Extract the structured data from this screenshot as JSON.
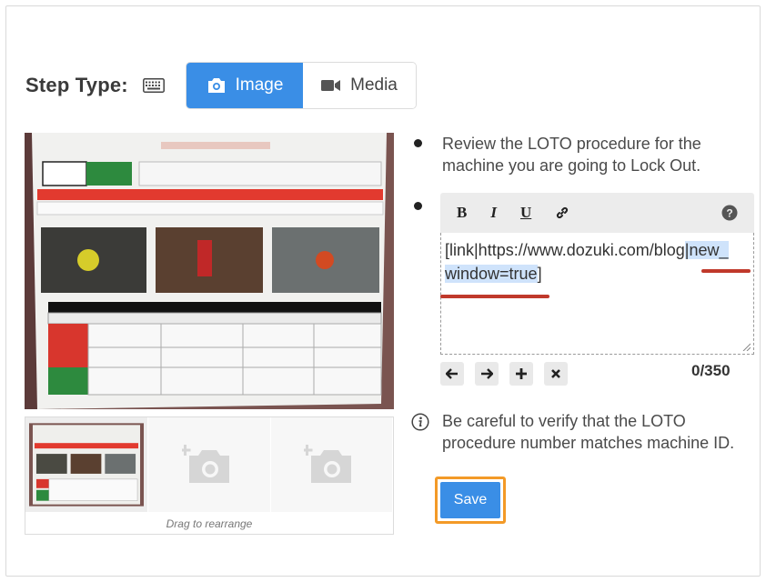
{
  "step_type": {
    "label": "Step Type:",
    "keyboard_icon": "keyboard-icon",
    "options": [
      {
        "label": "Image",
        "icon": "camera-icon",
        "active": true
      },
      {
        "label": "Media",
        "icon": "video-icon",
        "active": false
      }
    ],
    "accent_color": "#3a8ee6"
  },
  "image_panel": {
    "main_image_icon": "loto-procedure-photo",
    "thumbnails": [
      {
        "icon": "loto-procedure-thumbnail"
      },
      {
        "icon": "add-photo-icon"
      },
      {
        "icon": "add-photo-icon"
      }
    ],
    "drag_hint": "Drag to rearrange"
  },
  "lines": [
    {
      "type": "bullet",
      "text_line1": "Review the LOTO procedure for the",
      "text_line2": "machine you are going to Lock Out."
    },
    {
      "type": "bullet-editing"
    }
  ],
  "editor": {
    "toolbar": {
      "bold": "B",
      "italic": "I",
      "underline": "U",
      "link_icon": "link-icon",
      "help_icon": "help-icon"
    },
    "text_part1": "[link|https://www.dozuki.com/blog",
    "text_highlight1": "|new_",
    "text_highlight2": "window=true",
    "text_part2": "]",
    "counter": "0/350",
    "actions": [
      "arrow-left-icon",
      "arrow-right-icon",
      "plus-icon",
      "close-icon"
    ]
  },
  "info_line": {
    "icon": "info-icon",
    "text_line1": "Be careful to verify that the LOTO",
    "text_line2": "procedure number matches machine ID."
  },
  "save_label": "Save",
  "highlight_color": "#f39a27"
}
